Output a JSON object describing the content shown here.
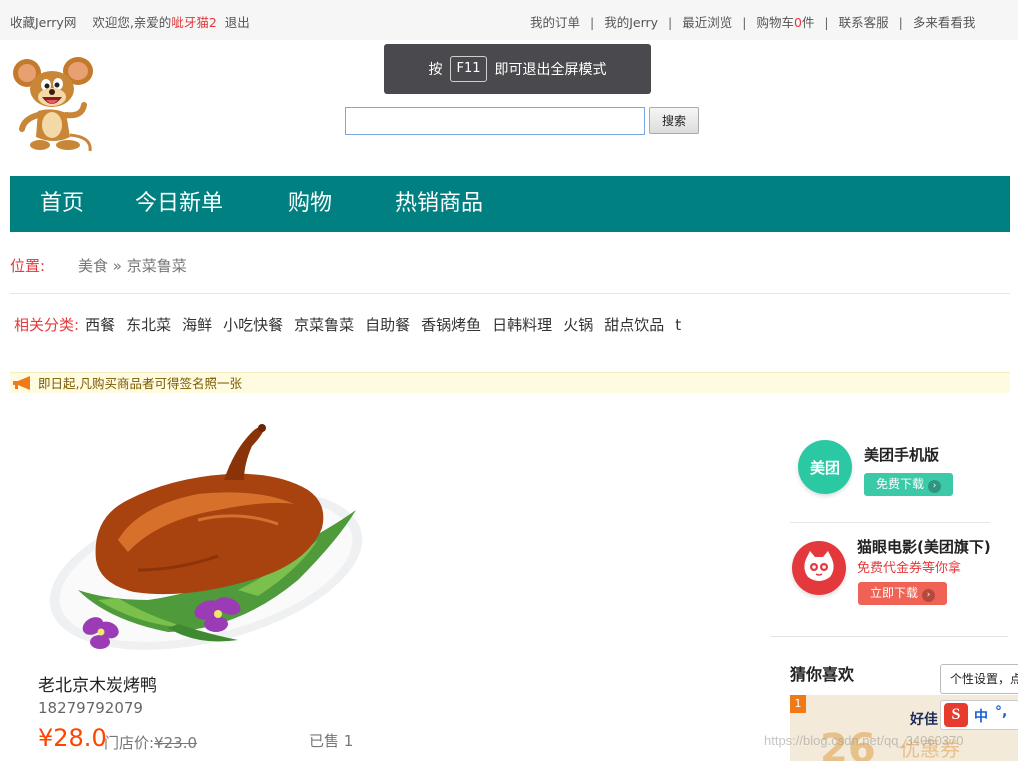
{
  "topbar": {
    "favorite": "收藏Jerry网",
    "welcome": "欢迎您,亲爱的",
    "username": "呲牙猫2",
    "logout": "退出",
    "links": {
      "orders": "我的订单",
      "my_jerry": "我的Jerry",
      "recent": "最近浏览",
      "cart_prefix": "购物车",
      "cart_count": "0",
      "cart_suffix": "件",
      "service": "联系客服",
      "more": "多来看看我"
    },
    "separator": "|"
  },
  "fullscreen_toast": {
    "press": "按",
    "key": "F11",
    "message": "即可退出全屏模式"
  },
  "search": {
    "value": "",
    "button": "搜索"
  },
  "nav": {
    "home": "首页",
    "today": "今日新单",
    "shopping": "购物",
    "hot": "热销商品"
  },
  "breadcrumb": {
    "label": "位置:",
    "path": "美食 » 京菜鲁菜"
  },
  "categories": {
    "label": "相关分类:",
    "items": [
      "西餐",
      "东北菜",
      "海鲜",
      "小吃快餐",
      "京菜鲁菜",
      "自助餐",
      "香锅烤鱼",
      "日韩料理",
      "火锅",
      "甜点饮品",
      "t"
    ]
  },
  "notice": "即日起,凡购买商品者可得签名照一张",
  "product": {
    "name": "老北京木炭烤鸭",
    "phone": "18279792079",
    "price": "¥28.0",
    "store_label": "门店价:",
    "store_price": "¥23.0",
    "sold": "已售 1"
  },
  "sidebar": {
    "meituan": {
      "icon_text": "美团",
      "title": "美团手机版",
      "button": "免费下载"
    },
    "maoyan": {
      "title": "猫眼电影(美团旗下)",
      "subtitle": "免费代金券等你拿",
      "button": "立即下载"
    },
    "guess_title": "猜你喜欢",
    "ad": {
      "rank": "1",
      "brand": "好佳",
      "text": "优惠券",
      "number": "26"
    }
  },
  "ime": {
    "tooltip": "个性设置，点",
    "logo": "S",
    "mode": "中",
    "punct": "°,"
  },
  "watermark": "https://blog.csdn.net/qq_34060370",
  "colors": {
    "teal_nav": "#008080",
    "accent_red": "#e4393c",
    "price_orange": "#ff4400",
    "meituan_green": "#2bc8a4",
    "maoyan_red": "#e4393c"
  }
}
